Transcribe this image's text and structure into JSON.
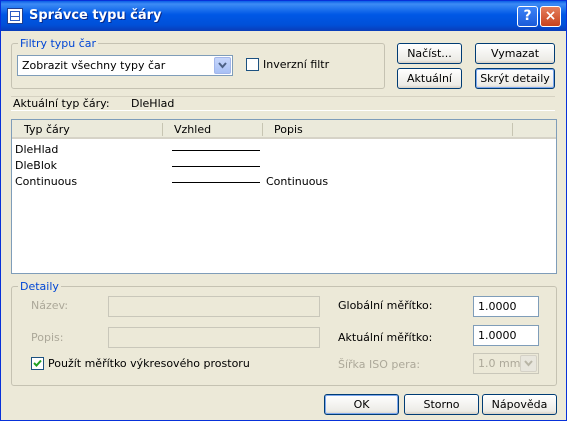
{
  "window": {
    "title": "Správce typu čáry",
    "help_label": "?",
    "close_label": "×"
  },
  "filters": {
    "legend": "Filtry typu čar",
    "selected_filter": "Zobrazit všechny typy čar",
    "invert_label": "Inverzní filtr",
    "invert_checked": false
  },
  "buttons": {
    "load": "Načíst...",
    "delete": "Vymazat",
    "current": "Aktuální",
    "hide_details": "Skrýt detaily",
    "ok": "OK",
    "cancel": "Storno",
    "help": "Nápověda"
  },
  "current_linetype": {
    "label": "Aktuální typ čáry:",
    "value": "DleHlad"
  },
  "list": {
    "columns": [
      "Typ čáry",
      "Vzhled",
      "Popis"
    ],
    "rows": [
      {
        "name": "DleHlad",
        "description": ""
      },
      {
        "name": "DleBlok",
        "description": ""
      },
      {
        "name": "Continuous",
        "description": "Continuous"
      }
    ]
  },
  "details": {
    "legend": "Detaily",
    "name_label": "Název:",
    "name_value": "",
    "description_label": "Popis:",
    "description_value": "",
    "paperspace_label": "Použít měřítko výkresového prostoru",
    "paperspace_checked": true,
    "global_scale_label": "Globální měřítko:",
    "global_scale_value": "1.0000",
    "current_scale_label": "Aktuální měřítko:",
    "current_scale_value": "1.0000",
    "iso_pen_label": "Šířka ISO pera:",
    "iso_pen_value": "1.0 mm"
  }
}
